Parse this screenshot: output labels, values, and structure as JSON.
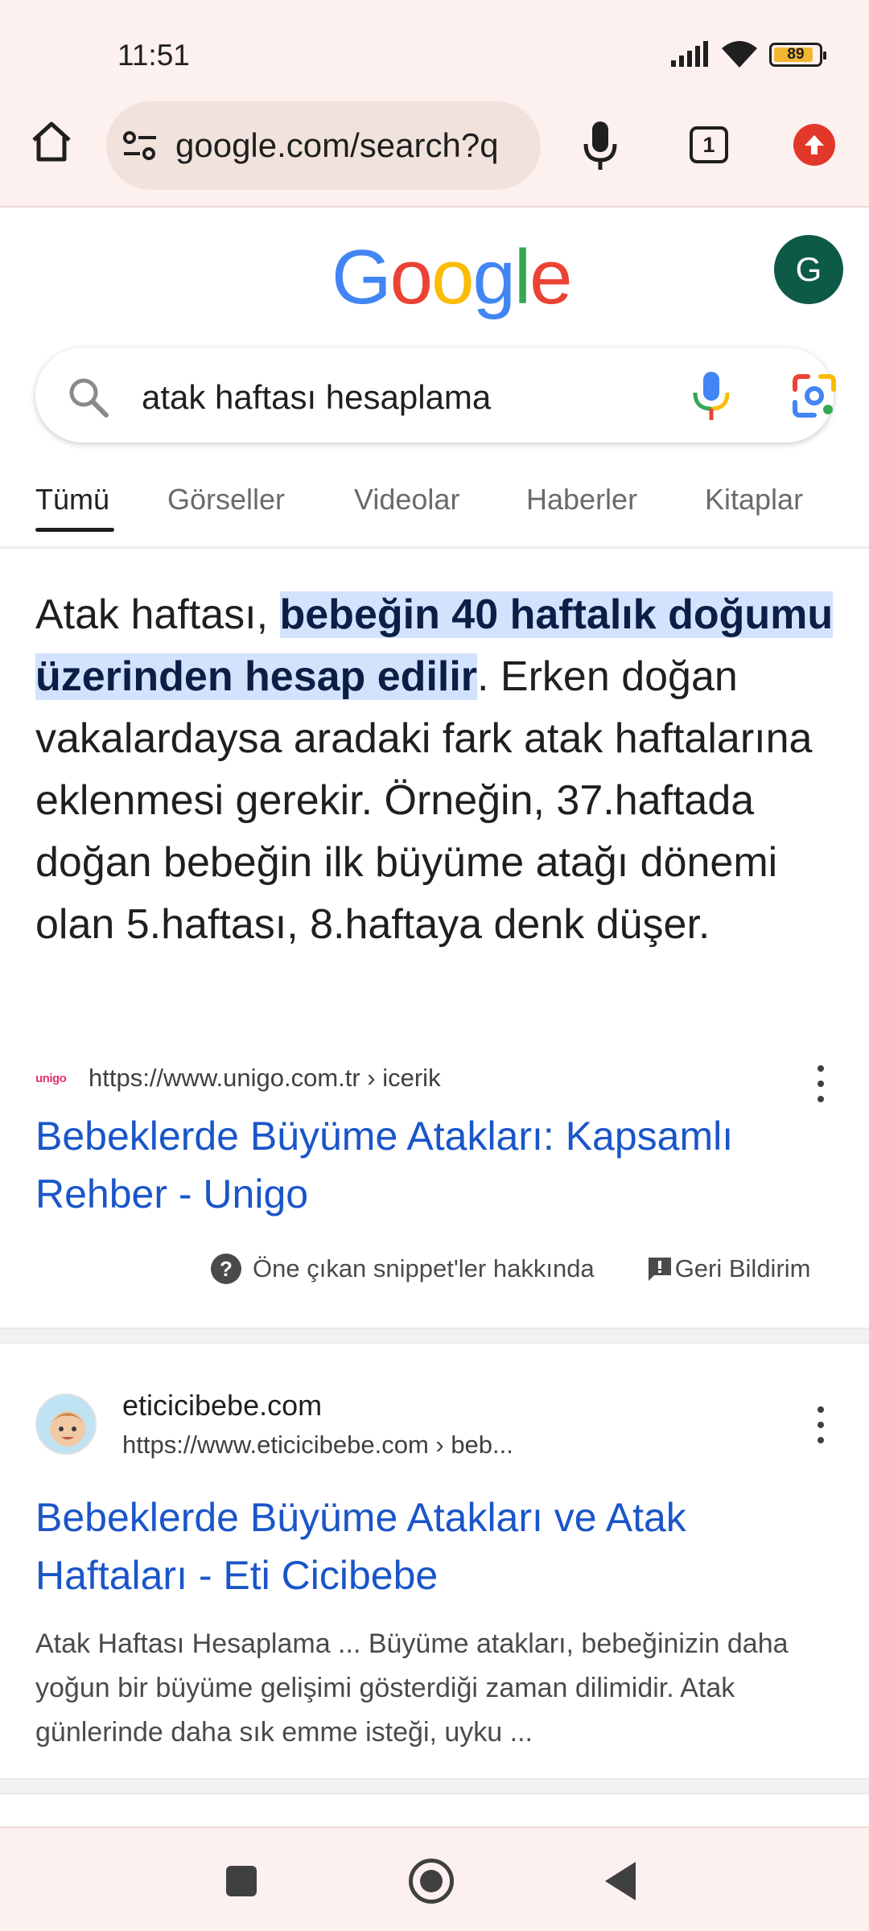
{
  "status_bar": {
    "time": "11:51",
    "battery": "89",
    "battery_level_percent": 89,
    "icons": [
      "signal-icon",
      "wifi-icon",
      "battery-icon"
    ]
  },
  "browser": {
    "url": "google.com/search?q",
    "open_tabs": "1",
    "icons": [
      "home-icon",
      "tune-icon",
      "microphone-icon",
      "tab-switcher-icon",
      "update-icon"
    ]
  },
  "google": {
    "logo_letters": [
      {
        "ch": "G",
        "color": "#4285f4"
      },
      {
        "ch": "o",
        "color": "#ea4335"
      },
      {
        "ch": "o",
        "color": "#fbbc05"
      },
      {
        "ch": "g",
        "color": "#4285f4"
      },
      {
        "ch": "l",
        "color": "#34a853"
      },
      {
        "ch": "e",
        "color": "#ea4335"
      }
    ],
    "avatar_letter": "G",
    "avatar_color": "#0d5a47"
  },
  "search": {
    "query": "atak haftası hesaplama",
    "icons": [
      "search-icon",
      "voice-search-icon",
      "google-lens-icon"
    ]
  },
  "tabs": [
    "Tümü",
    "Görseller",
    "Videolar",
    "Haberler",
    "Kitaplar"
  ],
  "active_tab": "Tümü",
  "snippet": {
    "text_before": "Atak haftası, ",
    "highlight": "bebeğin 40 haftalık doğumu üzerinden hesap edilir",
    "text_after": ". Erken doğan vakalardaysa aradaki fark atak haftalarına eklenmesi gerekir. Örneğin, 37.haftada doğan bebeğin ilk büyüme atağı dönemi olan 5.haftası, 8.haftaya denk düşer.",
    "highlight_color": "#d3e3fd"
  },
  "result1": {
    "favicon_text": "unigo",
    "url": "https://www.unigo.com.tr › icerik",
    "title": "Bebeklerde Büyüme Atakları: Kapsamlı Rehber - Unigo"
  },
  "snippet_footer": {
    "about": "Öne çıkan snippet'ler hakkında",
    "feedback": "Geri Bildirim"
  },
  "result2": {
    "site_name": "eticicibebe.com",
    "url": "https://www.eticicibebe.com › beb...",
    "title": "Bebeklerde Büyüme Atakları ve Atak Haftaları - Eti Cicibebe",
    "description": "Atak Haftası Hesaplama ... Büyüme atakları, bebeğinizin daha yoğun bir büyüme gelişimi gösterdiği zaman dilimidir. Atak günlerinde daha sık emme isteği, uyku ..."
  },
  "colors": {
    "link": "#1a55c9",
    "chrome_background": "#fcf1ef",
    "omnibox_background": "#f1e2dc",
    "update_badge": "#e2382a"
  },
  "nav_bar": {
    "icons": [
      "recents-icon",
      "home-icon",
      "back-icon"
    ]
  }
}
